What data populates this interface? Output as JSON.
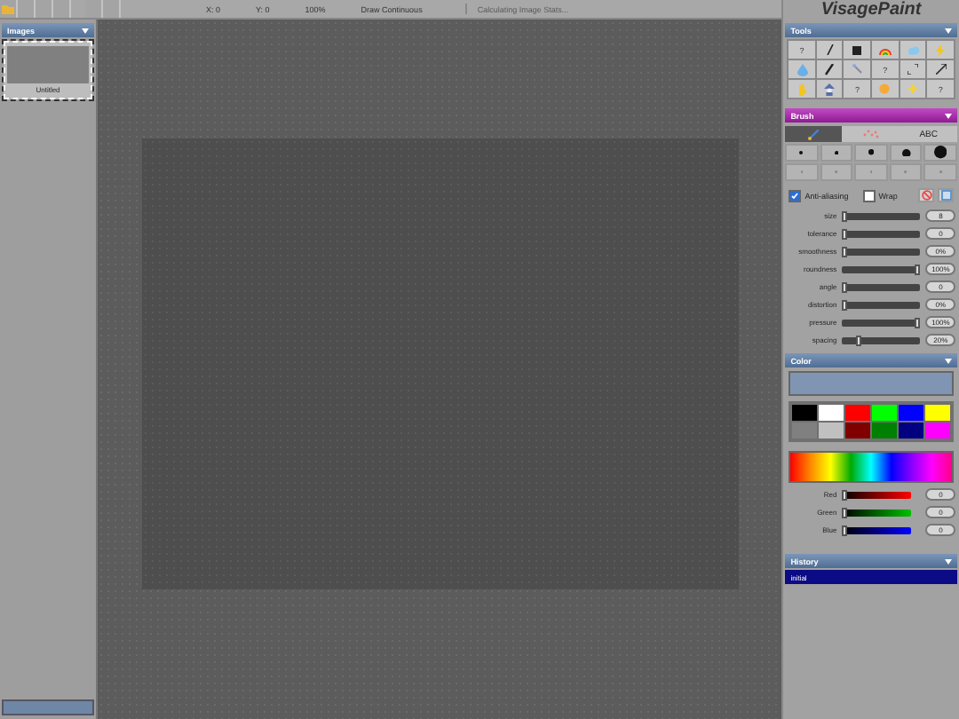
{
  "toolbar": {
    "buttons": [
      {
        "kind": "folder"
      },
      {
        "kind": "blank"
      },
      {
        "kind": "blank"
      },
      {
        "kind": "blank"
      },
      {
        "kind": "gap"
      },
      {
        "kind": "blank"
      },
      {
        "kind": "blank"
      }
    ],
    "status": [
      {
        "text": "X: 0",
        "disabled": false
      },
      {
        "text": "Y: 0",
        "disabled": false
      },
      {
        "text": "100%",
        "disabled": false
      },
      {
        "text": "Draw Continuous",
        "disabled": false
      },
      {
        "text": "Calculating Image Stats...",
        "disabled": true
      }
    ]
  },
  "images_panel": {
    "title": "Images",
    "items": [
      {
        "name": "Untitled",
        "selected": true
      }
    ]
  },
  "app_title": "VisagePaint",
  "tools_panel": {
    "title": "Tools",
    "tools": [
      {
        "kind": "text",
        "label": "?"
      },
      {
        "kind": "line"
      },
      {
        "kind": "rect"
      },
      {
        "kind": "rainbow"
      },
      {
        "kind": "cloud"
      },
      {
        "kind": "bolt"
      },
      {
        "kind": "drop"
      },
      {
        "kind": "brush"
      },
      {
        "kind": "wand"
      },
      {
        "kind": "text",
        "label": "?"
      },
      {
        "kind": "resize"
      },
      {
        "kind": "arrow"
      },
      {
        "kind": "hand"
      },
      {
        "kind": "figure"
      },
      {
        "kind": "text",
        "label": "?"
      },
      {
        "kind": "sun"
      },
      {
        "kind": "star"
      },
      {
        "kind": "text",
        "label": "?"
      }
    ]
  },
  "brush_panel": {
    "title": "Brush",
    "tabs": [
      {
        "kind": "brush",
        "selected": true
      },
      {
        "kind": "spray",
        "selected": false
      },
      {
        "kind": "text",
        "label": "ABC",
        "selected": false
      }
    ],
    "options": [
      {
        "label": "Anti-aliasing",
        "checked": true
      },
      {
        "label": "Wrap",
        "checked": false
      }
    ],
    "sliders": [
      {
        "name": "size",
        "level": 0.0,
        "value": "8"
      },
      {
        "name": "tolerance",
        "level": 0.0,
        "value": "0"
      },
      {
        "name": "smoothness",
        "level": 0.0,
        "value": "0%"
      },
      {
        "name": "roundness",
        "level": 1.0,
        "value": "100%"
      },
      {
        "name": "angle",
        "level": 0.0,
        "value": "0"
      },
      {
        "name": "distortion",
        "level": 0.0,
        "value": "0%"
      },
      {
        "name": "pressure",
        "level": 1.0,
        "value": "100%"
      },
      {
        "name": "spacing",
        "level": 0.2,
        "value": "20%"
      }
    ]
  },
  "color_panel": {
    "title": "Color",
    "swatches": [
      {
        "color": "#000000"
      },
      {
        "color": "#ffffff"
      },
      {
        "color": "#ff0000"
      },
      {
        "color": "#00ff00"
      },
      {
        "color": "#0000ff"
      },
      {
        "color": "#ffff00"
      },
      {
        "color": "#808080"
      },
      {
        "color": "#c0c0c0"
      },
      {
        "color": "#800000"
      },
      {
        "color": "#008000"
      },
      {
        "color": "#000080"
      },
      {
        "color": "#ff00ff"
      }
    ],
    "channels": [
      {
        "name": "Red",
        "level": 0.0,
        "value": "0"
      },
      {
        "name": "Green",
        "level": 0.0,
        "value": "0"
      },
      {
        "name": "Blue",
        "level": 0.0,
        "value": "0"
      }
    ]
  },
  "history_panel": {
    "title": "History",
    "items": [
      {
        "label": "initial",
        "selected": true
      }
    ]
  }
}
